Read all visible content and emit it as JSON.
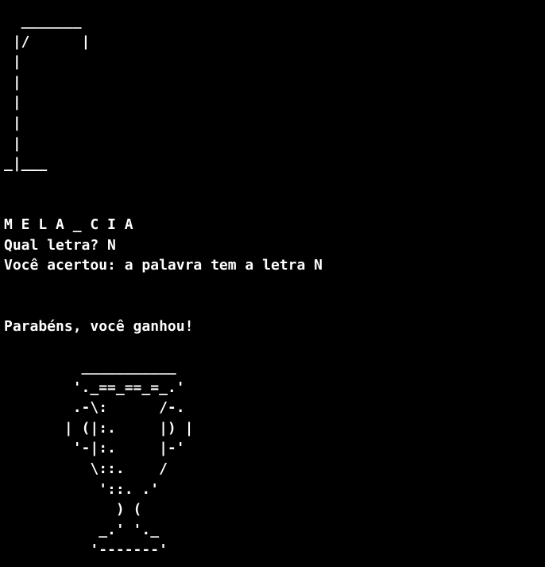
{
  "terminal": {
    "gallows": [
      "  _______",
      " |/      |",
      " |",
      " |",
      " |",
      " |",
      " |",
      "_|___"
    ],
    "word_progress": "M E L A _ C I A",
    "prompt": "Qual letra? N",
    "feedback": "Você acertou: a palavra tem a letra N",
    "win_message": "Parabéns, você ganhou!",
    "trophy": [
      "         ___________",
      "        '._==_==_=_.'",
      "        .-\\:      /-.",
      "       | (|:.     |) |",
      "        '-|:.     |-'",
      "          \\::.    /",
      "           '::. .'",
      "             ) (",
      "           _.' '._",
      "          '-------'"
    ]
  },
  "colors": {
    "background": "#000000",
    "foreground": "#ffffff"
  }
}
